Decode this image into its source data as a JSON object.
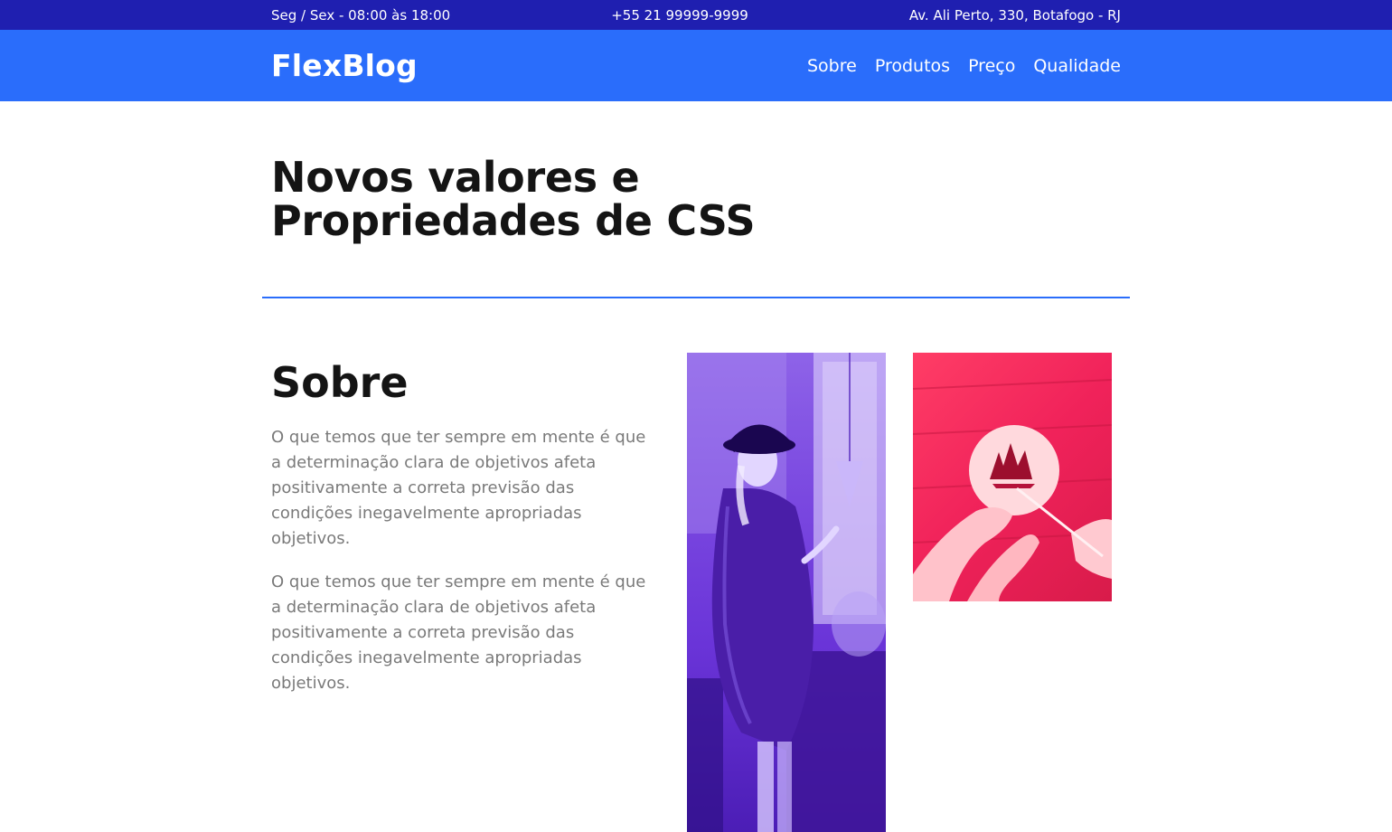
{
  "topbar": {
    "hours": "Seg / Sex - 08:00 às 18:00",
    "phone": "+55 21 99999-9999",
    "address": "Av. Ali Perto, 330, Botafogo - RJ"
  },
  "header": {
    "logo": "FlexBlog",
    "nav": [
      "Sobre",
      "Produtos",
      "Preço",
      "Qualidade"
    ]
  },
  "hero": {
    "title_line1": "Novos valores e",
    "title_line2": "Propriedades de CSS"
  },
  "about": {
    "heading": "Sobre",
    "paragraphs": [
      "O que temos que ter sempre em mente é que a determinação clara de objetivos afeta positivamente a correta previsão das condições inegavelmente apropriadas objetivos.",
      "O que temos que ter sempre em mente é que a determinação clara de objetivos afeta positivamente a correta previsão das condições inegavelmente apropriadas objetivos."
    ]
  },
  "colors": {
    "topbar": "#1f1fb0",
    "header": "#2a6dfb",
    "divider": "#2a6dfb",
    "image_purple": "#7a48e0",
    "image_pink": "#f0225a"
  }
}
